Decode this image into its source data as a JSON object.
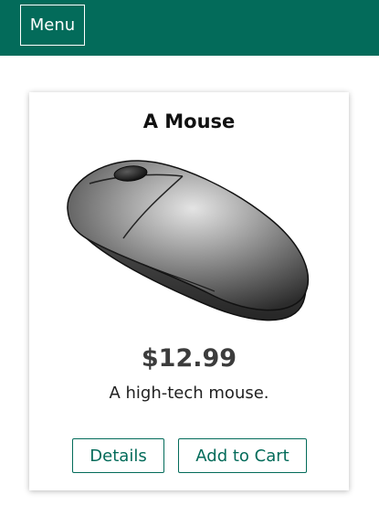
{
  "header": {
    "menu_label": "Menu"
  },
  "product": {
    "title": "A Mouse",
    "image_icon": "computer-mouse",
    "price": "$12.99",
    "description": "A high-tech mouse.",
    "details_label": "Details",
    "add_to_cart_label": "Add to Cart"
  },
  "colors": {
    "accent": "#036b5a",
    "header_bg": "#036b5a",
    "card_bg": "#ffffff"
  }
}
